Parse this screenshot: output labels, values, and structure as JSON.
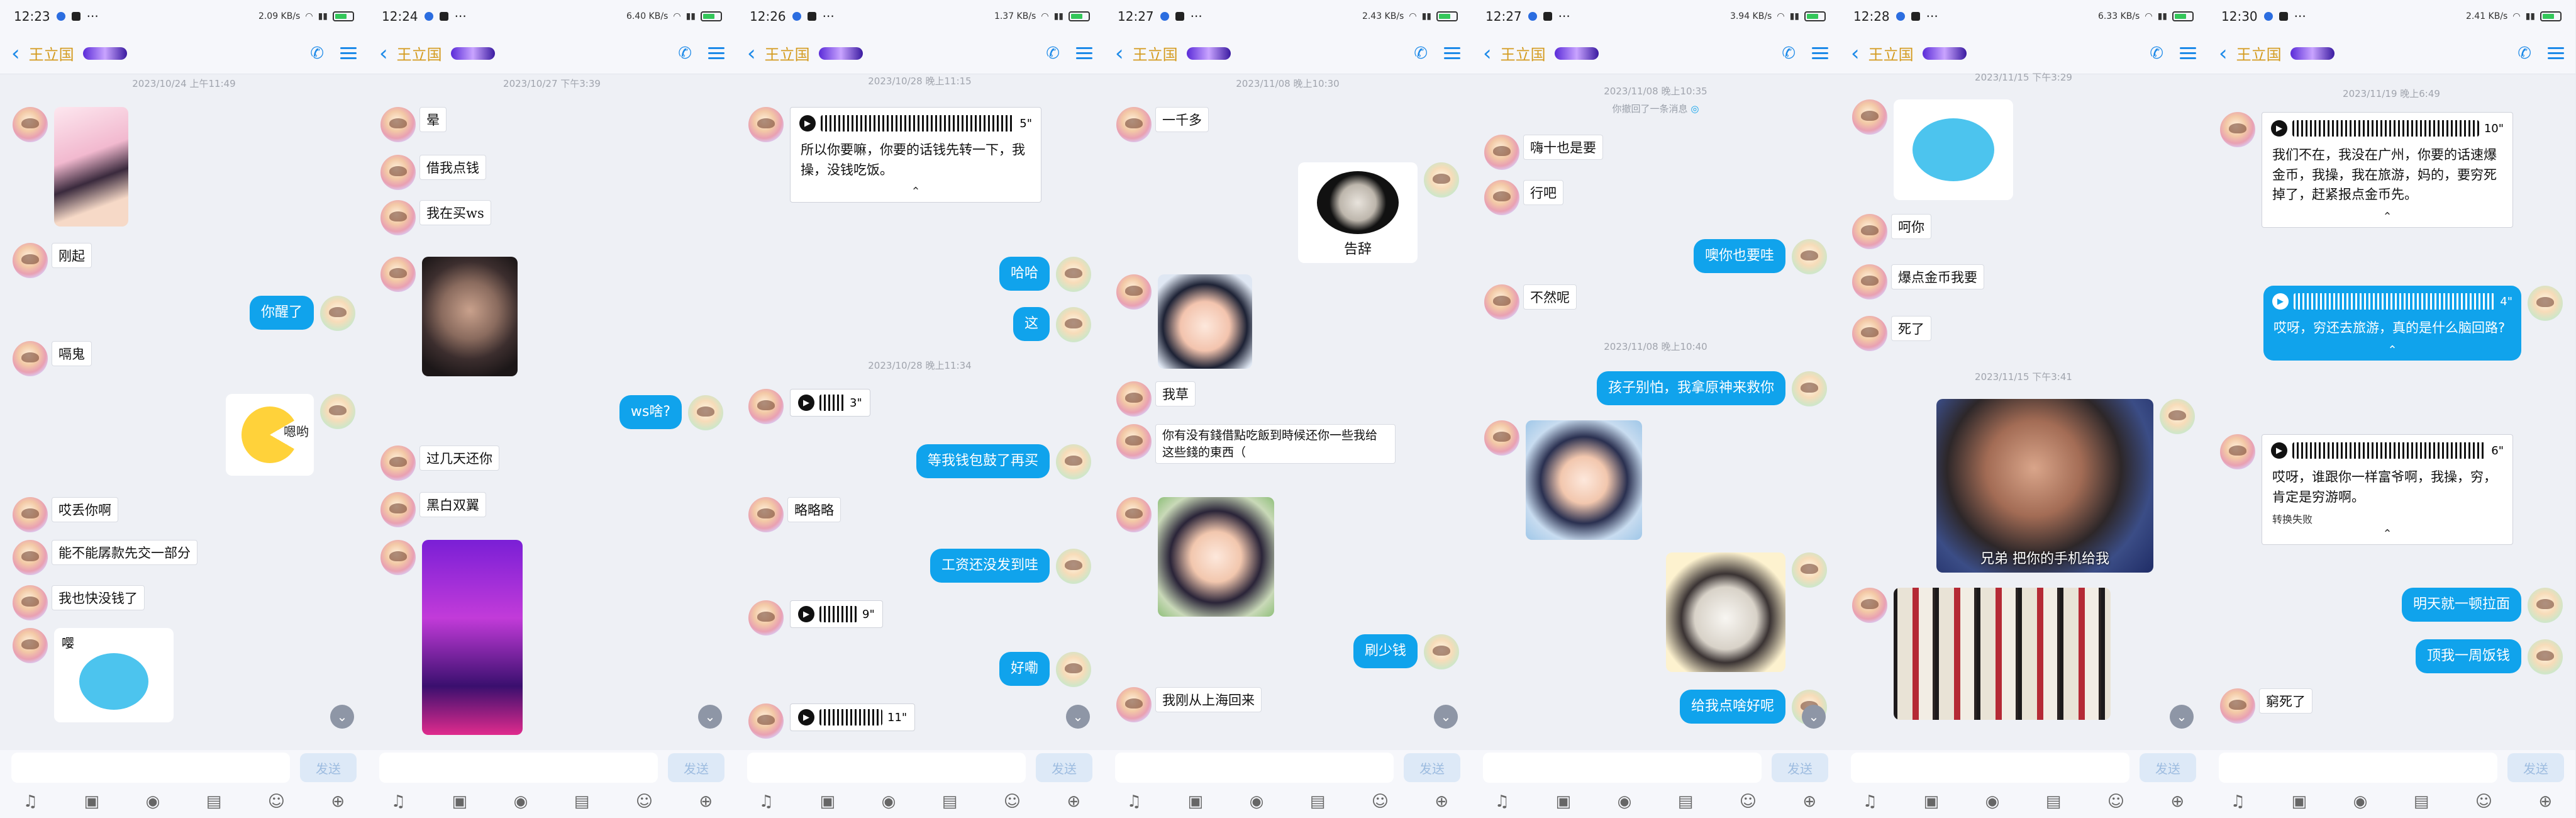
{
  "common": {
    "contact_name": "王立国",
    "send_label": "发送",
    "icons": [
      "mic-icon",
      "image-icon",
      "camera-icon",
      "file-icon",
      "emoji-icon",
      "plus-icon"
    ]
  },
  "screens": [
    {
      "time": "12:23",
      "net": "2.09 KB/s",
      "stamps": [
        "2023/10/24 上午11:49"
      ],
      "stickers": {
        "a": "刚起",
        "b": "嗝鬼",
        "c": "哎丢你啊",
        "d": "能不能孱款先交一部分",
        "e": "我也快没钱了",
        "f": "嘤",
        "pac": "嗯哟"
      },
      "bubbles": {
        "a": "你醒了"
      }
    },
    {
      "time": "12:24",
      "net": "6.40 KB/s",
      "stamps": [
        "2023/10/27 下午3:39"
      ],
      "stickers": {
        "a": "晕",
        "b": "借我点钱",
        "c": "我在买ws",
        "d": "过几天还你",
        "e": "黑白双翼"
      },
      "bubbles": {
        "a": "ws啥?"
      }
    },
    {
      "time": "12:26",
      "net": "1.37 KB/s",
      "stamps": [
        "2023/10/28 晚上11:15",
        "2023/10/28 晚上11:34"
      ],
      "voice": {
        "dur": "5\"",
        "text": "所以你要嘛，你要的话钱先转一下，我操，没钱吃饭。"
      },
      "voices_mini": [
        {
          "dur": "3\""
        },
        {
          "dur": "9\""
        },
        {
          "dur": "11\""
        }
      ],
      "stickers": {
        "a": "略略略"
      },
      "bubbles": {
        "a": "哈哈",
        "b": "这",
        "c": "等我钱包鼓了再买",
        "d": "工资还没发到哇",
        "e": "好嘞"
      }
    },
    {
      "time": "12:27",
      "net": "2.43 KB/s",
      "stamps": [
        "2023/11/08 晚上10:30"
      ],
      "stickers": {
        "a": "一千多",
        "b": "我草",
        "c": "你有没有錢借點吃飯到時候还你一些我给这些錢的東西（",
        "d": "我刚从上海回来"
      },
      "panda": "告辞",
      "bubbles": {
        "a": "刷少钱"
      }
    },
    {
      "time": "12:27",
      "net": "3.94 KB/s",
      "stamps": [
        "2023/11/08 晚上10:35",
        "2023/11/08 晚上10:40"
      ],
      "system": "你撤回了一条消息",
      "stickers": {
        "a": "嗨十也是要",
        "b": "行吧",
        "c": "不然呢"
      },
      "bubbles": {
        "a": "噢你也要哇",
        "b": "孩子别怕，我拿原神来救你",
        "c": "给我点啥好呢"
      }
    },
    {
      "time": "12:28",
      "net": "6.33 KB/s",
      "stamps": [
        "2023/11/15 下午3:29",
        "2023/11/15 下午3:41"
      ],
      "stickers": {
        "a": "呵你",
        "b": "爆点金币我要",
        "c": "死了"
      },
      "photo_caption": "兄弟 把你的手机给我"
    },
    {
      "time": "12:30",
      "net": "2.41 KB/s",
      "stamps": [
        "2023/11/19 晚上6:49"
      ],
      "voices": [
        {
          "dur": "10\"",
          "text": "我们不在，我没在广州，你要的话速爆金币，我操，我在旅游，妈的，要穷死掉了，赶紧报点金币先。"
        },
        {
          "dur": "4\"",
          "text": "哎呀，穷还去旅游，真的是什么脑回路?"
        },
        {
          "dur": "6\"",
          "text": "哎呀，谁跟你一样富爷啊，我操，穷，肯定是穷游啊。",
          "fail": "转换失败"
        }
      ],
      "stickers": {
        "a": "窮死了"
      },
      "bubbles": {
        "a": "明天就一顿拉面",
        "b": "顶我一周饭钱"
      }
    }
  ]
}
